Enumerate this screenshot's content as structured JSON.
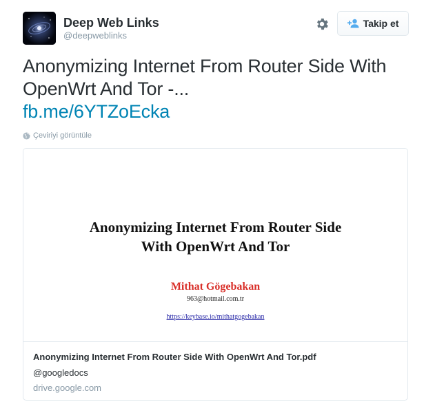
{
  "author": {
    "fullname": "Deep Web Links",
    "username": "@deepweblinks",
    "avatar_icon": "galaxy-avatar"
  },
  "actions": {
    "settings_icon": "gear-icon",
    "follow_label": "Takip et",
    "follow_icon": "add-user-icon"
  },
  "tweet": {
    "text": "Anonymizing Internet From Router Side With OpenWrt And Tor -...",
    "link": "fb.me/6YTZoEcka",
    "translate_label": "Çeviriyi görüntüle"
  },
  "card": {
    "preview": {
      "title_line1": "Anonymizing Internet From Router Side",
      "title_line2": "With OpenWrt And Tor",
      "author_name": "Mithat Gögebakan",
      "email": "963@hotmail.com.tr",
      "url": "https://keybase.io/mithatgogebakan"
    },
    "title": "Anonymizing Internet From Router Side With OpenWrt And Tor.pdf",
    "handle": "@googledocs",
    "domain": "drive.google.com"
  },
  "colors": {
    "link": "#0084b4",
    "muted": "#8899a6",
    "text": "#292f33",
    "author_red": "#d9302a",
    "border": "#e1e8ed"
  }
}
